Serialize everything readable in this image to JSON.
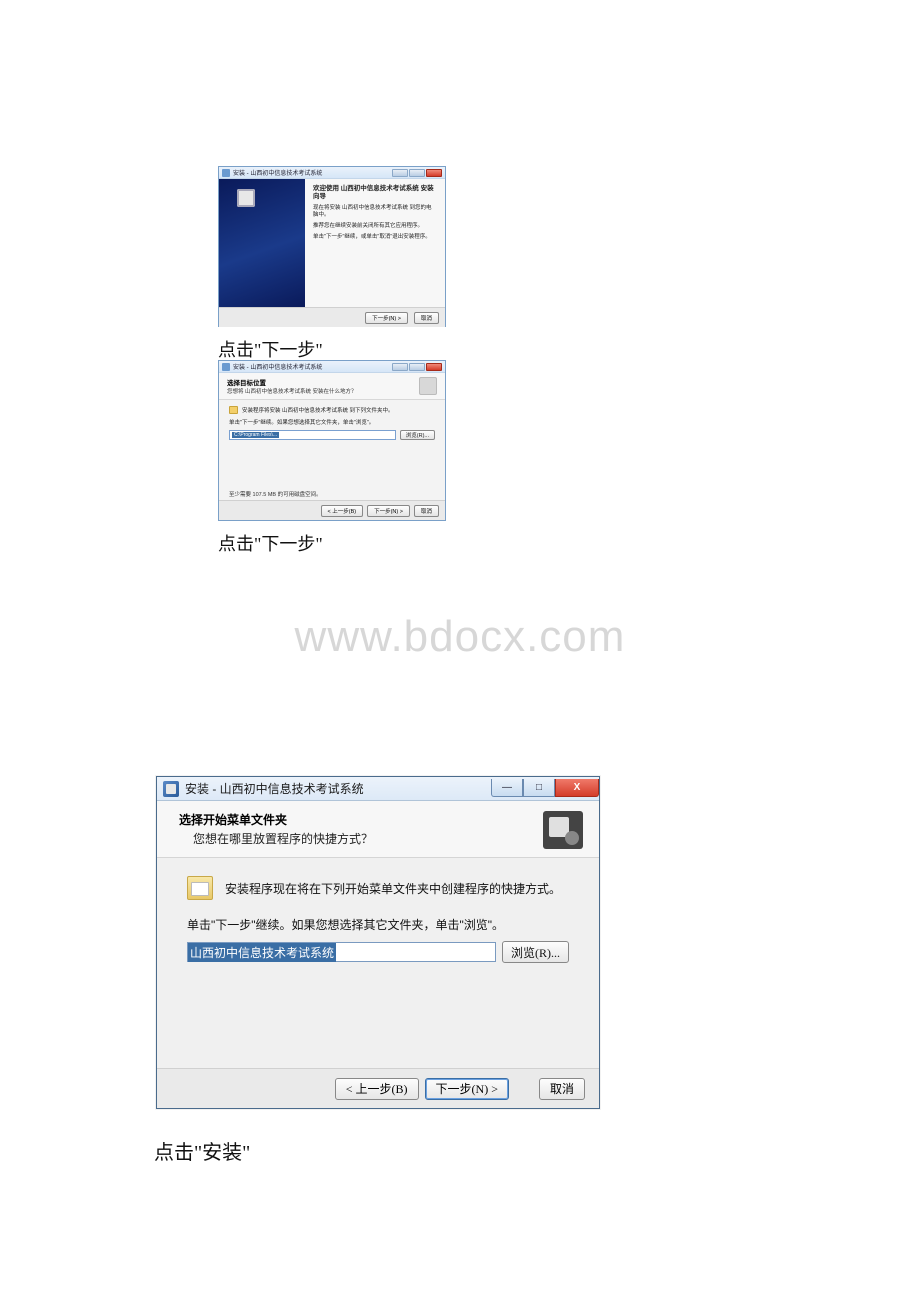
{
  "win1": {
    "title": "安装 - 山西初中信息技术考试系统",
    "heading": "欢迎使用 山西初中信息技术考试系统 安装向导",
    "p1": "现在将安装 山西初中信息技术考试系统 到您的电脑中。",
    "p2": "推荐您在继续安装前关闭所有其它应用程序。",
    "p3": "单击\"下一步\"继续，或单击\"取消\"退出安装程序。",
    "next": "下一步(N) >",
    "cancel": "取消"
  },
  "caption1": "点击\"下一步\"",
  "win2": {
    "title": "安装 - 山西初中信息技术考试系统",
    "sub_b": "选择目标位置",
    "sub_s": "您想将 山西初中信息技术考试系统 安装在什么地方？",
    "line1": "安装程序将安装 山西初中信息技术考试系统 到下列文件夹中。",
    "line2": "单击\"下一步\"继续。如果您想选择其它文件夹，单击\"浏览\"。",
    "path": "C:\\Program Files\\...",
    "browse": "浏览(R)...",
    "disk": "至少需要 107.5 MB 的可用磁盘空间。",
    "back": "< 上一步(B)",
    "next": "下一步(N) >",
    "cancel": "取消"
  },
  "caption2": "点击\"下一步\"",
  "watermark": "www.bdocx.com",
  "win3": {
    "title": "安装 - 山西初中信息技术考试系统",
    "sub_b": "选择开始菜单文件夹",
    "sub_s": "您想在哪里放置程序的快捷方式？",
    "line1": "安装程序现在将在下列开始菜单文件夹中创建程序的快捷方式。",
    "line2": "单击\"下一步\"继续。如果您想选择其它文件夹，单击\"浏览\"。",
    "path": "山西初中信息技术考试系统",
    "browse": "浏览(R)...",
    "back": "< 上一步(B)",
    "next": "下一步(N) >",
    "cancel": "取消",
    "min": "—",
    "max": "□",
    "close": "X"
  },
  "caption3": "点击\"安装\""
}
